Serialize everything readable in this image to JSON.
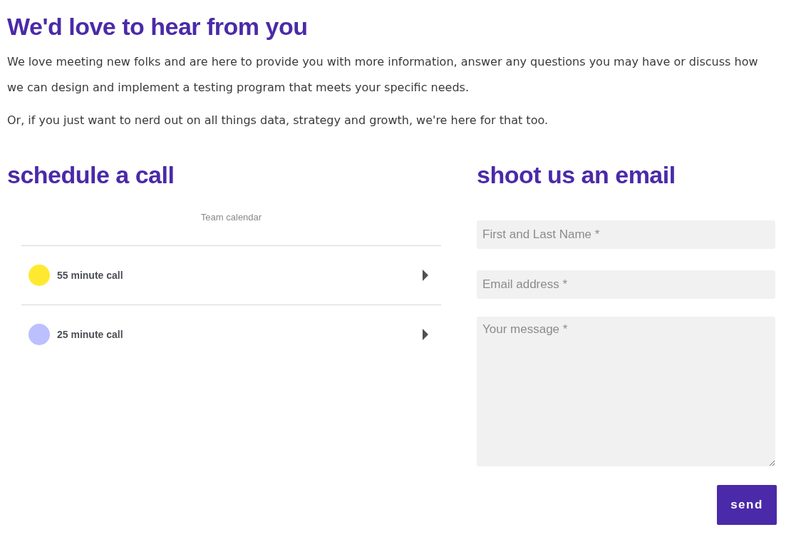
{
  "heading": "We'd love to hear from you",
  "paragraphs": [
    "We love meeting new folks and are here to provide you with more information, answer any questions you may have or discuss how we can design and implement a testing program that meets your specific needs.",
    "Or, if you just want to nerd out on all things data, strategy and growth, we're here for that too."
  ],
  "schedule": {
    "title": "schedule a call",
    "calendar_label": "Team calendar",
    "events": [
      {
        "name": "55 minute call",
        "color": "#ffe930"
      },
      {
        "name": "25 minute call",
        "color": "#bcc0ff"
      }
    ]
  },
  "email": {
    "title": "shoot us an email",
    "fields": [
      {
        "kind": "input",
        "placeholder": "First and Last Name *"
      },
      {
        "kind": "input",
        "placeholder": "Email address *"
      },
      {
        "kind": "textarea",
        "placeholder": "Your message *"
      }
    ],
    "button": "send"
  }
}
